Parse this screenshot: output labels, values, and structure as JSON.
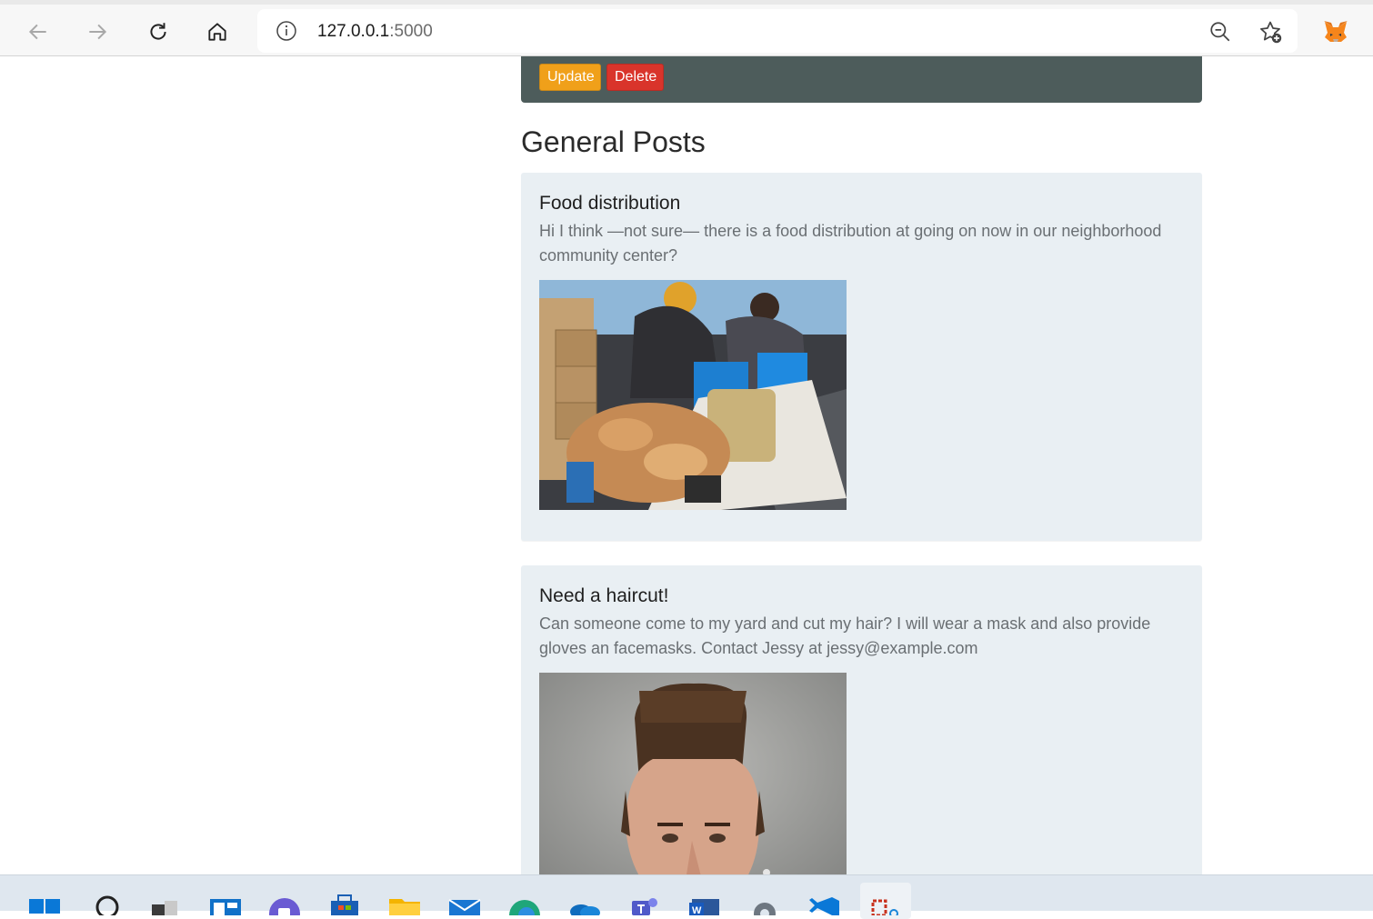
{
  "browser": {
    "url_host": "127.0.0.1",
    "url_port": ":5000"
  },
  "admin_bar": {
    "update_label": "Update",
    "delete_label": "Delete"
  },
  "section_title": "General Posts",
  "posts": [
    {
      "title": "Food distribution",
      "body": "Hi I think —not sure— there is a food distribution at going on now in our neighborhood community center?",
      "image": "food-distribution-photo"
    },
    {
      "title": "Need a haircut!",
      "body": "Can someone come to my yard and cut my hair? I will wear a mask and also provide gloves an facemasks. Contact Jessy at jessy@example.com",
      "image": "haircut-photo"
    }
  ],
  "colors": {
    "admin_bar": "#4d5c5b",
    "update_button": "#f0a01a",
    "delete_button": "#d9342b",
    "card_bg": "#e9eff3"
  },
  "taskbar_icons": [
    "start-icon",
    "search-icon",
    "task-view-icon",
    "widgets-icon",
    "teams-chat-icon",
    "store-icon",
    "file-explorer-icon",
    "mail-icon",
    "edge-icon",
    "onedrive-icon",
    "teams-icon",
    "word-icon",
    "settings-icon",
    "vscode-icon",
    "snipping-tool-icon"
  ]
}
